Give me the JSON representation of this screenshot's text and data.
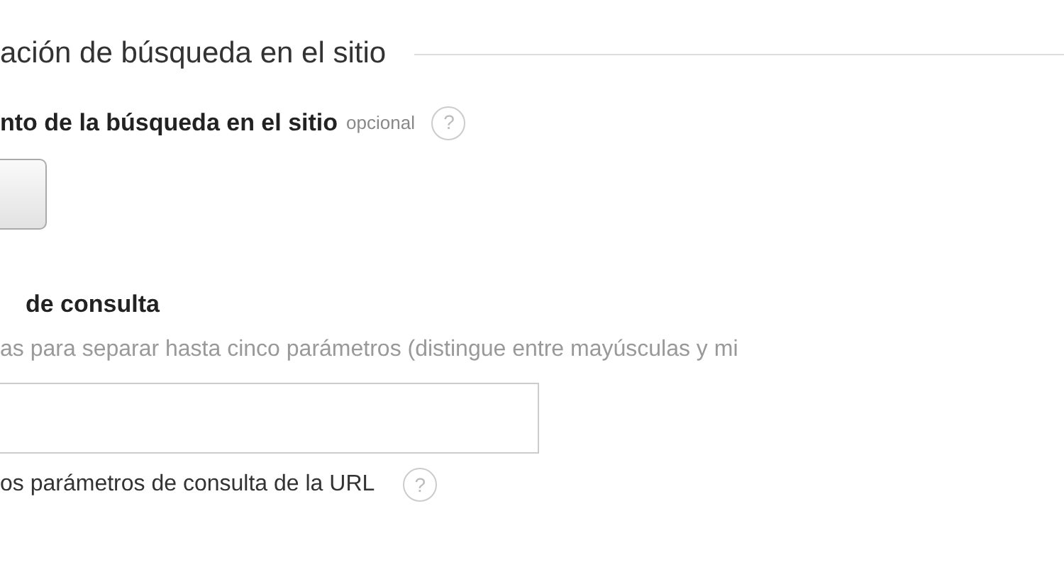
{
  "section_title": "ación de búsqueda en el sitio",
  "category_field": {
    "label": "nto de la búsqueda en el sitio",
    "optional_note": "opcional",
    "help": "?"
  },
  "query_field": {
    "label": "de consulta",
    "hint": "as para separar hasta cinco parámetros (distingue entre mayúsculas y mi"
  },
  "strip_option": {
    "label": "os parámetros de consulta de la URL",
    "help": "?"
  }
}
